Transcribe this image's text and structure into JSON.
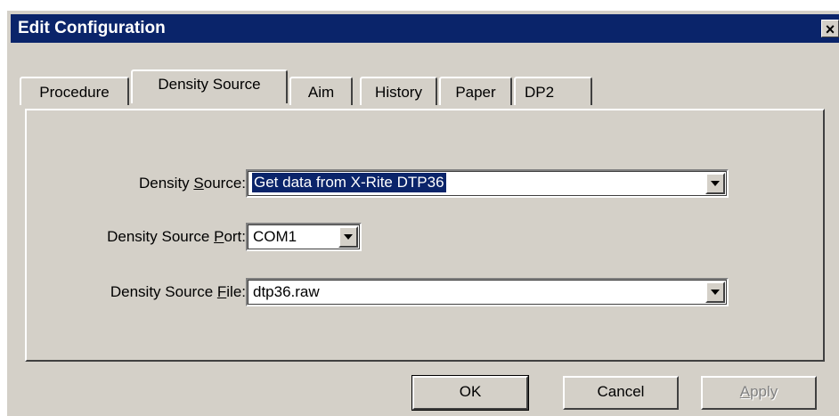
{
  "window": {
    "title": "Edit Configuration",
    "close_glyph": "×"
  },
  "tabs": [
    {
      "label": "Procedure",
      "active": false
    },
    {
      "label": "Density Source",
      "active": true
    },
    {
      "label": "Aim",
      "active": false
    },
    {
      "label": "History",
      "active": false
    },
    {
      "label": "Paper",
      "active": false
    },
    {
      "label": "DP2",
      "active": false
    }
  ],
  "form": {
    "density_source": {
      "label_pre": "Density ",
      "label_key": "S",
      "label_post": "ource:",
      "value": "Get data from X-Rite DTP36"
    },
    "density_source_port": {
      "label_pre": "Density Source ",
      "label_key": "P",
      "label_post": "ort:",
      "value": "COM1"
    },
    "density_source_file": {
      "label_pre": "Density Source ",
      "label_key": "F",
      "label_post": "ile:",
      "value": "dtp36.raw"
    }
  },
  "buttons": {
    "ok": "OK",
    "cancel": "Cancel",
    "apply_key": "A",
    "apply_rest": "pply"
  },
  "icons": {
    "dropdown": "chevron-down-icon",
    "close": "close-icon"
  },
  "colors": {
    "titlebar": "#0a246a",
    "face": "#d4d0c8",
    "selection": "#0a246a"
  }
}
